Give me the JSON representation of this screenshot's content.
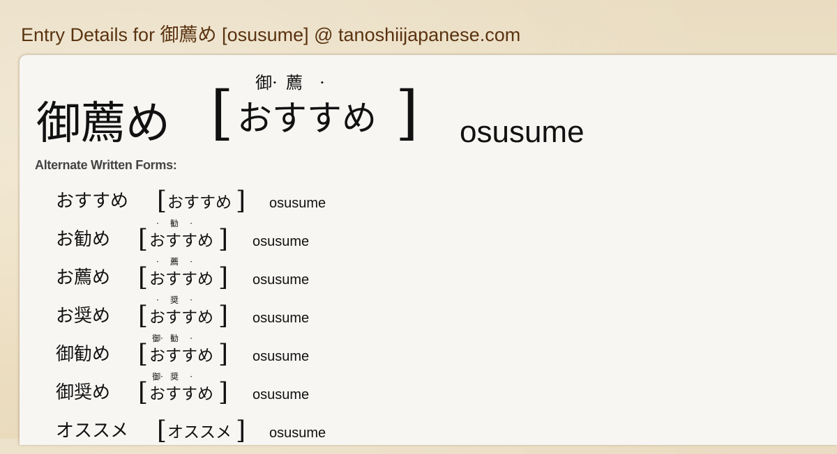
{
  "header": {
    "title": "Entry Details for 御薦め [osusume] @ tanoshiijapanese.com"
  },
  "entry": {
    "kanji": "御薦め",
    "bracket_open": "[",
    "bracket_close": "]",
    "ruby": [
      "御·",
      "薦",
      "·",
      ""
    ],
    "kana": "おすすめ",
    "romaji": "osusume"
  },
  "alternate": {
    "label": "Alternate Written Forms:",
    "forms": [
      {
        "kanji": "おすすめ",
        "ruby": [
          "",
          "",
          "",
          ""
        ],
        "kana": "おすすめ",
        "romaji": "osusume"
      },
      {
        "kanji": "お勧め",
        "ruby": [
          "·",
          "勧",
          "·",
          ""
        ],
        "kana": "おすすめ",
        "romaji": "osusume"
      },
      {
        "kanji": "お薦め",
        "ruby": [
          "·",
          "薦",
          "·",
          ""
        ],
        "kana": "おすすめ",
        "romaji": "osusume"
      },
      {
        "kanji": "お奨め",
        "ruby": [
          "·",
          "奨",
          "·",
          ""
        ],
        "kana": "おすすめ",
        "romaji": "osusume"
      },
      {
        "kanji": "御勧め",
        "ruby": [
          "御·",
          "勧",
          "·",
          ""
        ],
        "kana": "おすすめ",
        "romaji": "osusume"
      },
      {
        "kanji": "御奨め",
        "ruby": [
          "御·",
          "奨",
          "·",
          ""
        ],
        "kana": "おすすめ",
        "romaji": "osusume"
      },
      {
        "kanji": "オススメ",
        "ruby": [
          "",
          "",
          "",
          ""
        ],
        "kana": "オススメ",
        "romaji": "osusume"
      }
    ]
  }
}
